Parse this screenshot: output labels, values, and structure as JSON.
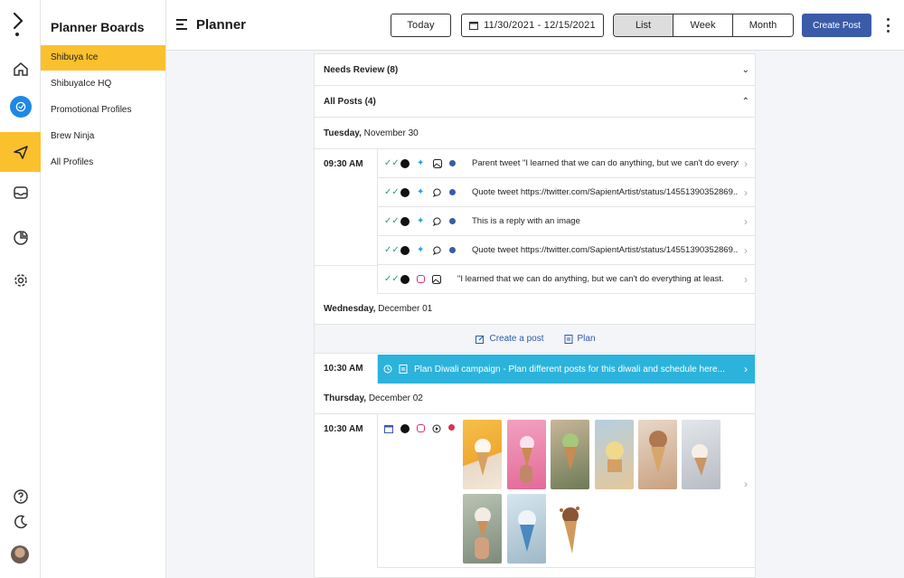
{
  "rail": {
    "items": [
      "home-icon",
      "planner-icon",
      "send-icon",
      "inbox-icon",
      "analytics-icon",
      "settings-icon"
    ],
    "bottom": [
      "help-icon",
      "dark-mode-icon",
      "user-avatar"
    ]
  },
  "boards": {
    "title": "Planner Boards",
    "items": [
      {
        "label": "Shibuya Ice",
        "active": true
      },
      {
        "label": "ShibuyaIce HQ"
      },
      {
        "label": "Promotional Profiles"
      },
      {
        "label": "Brew Ninja"
      },
      {
        "label": "All Profiles"
      }
    ]
  },
  "header": {
    "title": "Planner",
    "today": "Today",
    "date_range": "11/30/2021 - 12/15/2021",
    "views": [
      "List",
      "Week",
      "Month"
    ],
    "active_view": "List",
    "create_post": "Create Post"
  },
  "sections": {
    "needs_review": "Needs Review (8)",
    "all_posts": "All Posts (4)"
  },
  "days": [
    {
      "weekday": "Tuesday,",
      "date": "November 30",
      "time1": "09:30 AM",
      "posts": [
        "Parent tweet \"I learned that we can do anything, but we can't do everythi...",
        "Quote tweet https://twitter.com/SapientArtist/status/14551390352869...",
        "This is a reply with an image",
        "Quote tweet https://twitter.com/SapientArtist/status/14551390352869..."
      ],
      "post_ig": "\"I learned that we can do anything, but we can't do everything at least..."
    },
    {
      "weekday": "Wednesday,",
      "date": "December 01",
      "create_post": "Create a post",
      "plan": "Plan",
      "time": "10:30 AM",
      "plan_text": "Plan Diwali campaign - Plan different posts for this diwali and schedule here..."
    },
    {
      "weekday": "Thursday,",
      "date": "December 02",
      "time": "10:30 AM"
    }
  ],
  "colors": {
    "accent_yellow": "#fbc02d",
    "primary_blue": "#3b5ba9",
    "plan_cyan": "#2bb3dc"
  }
}
